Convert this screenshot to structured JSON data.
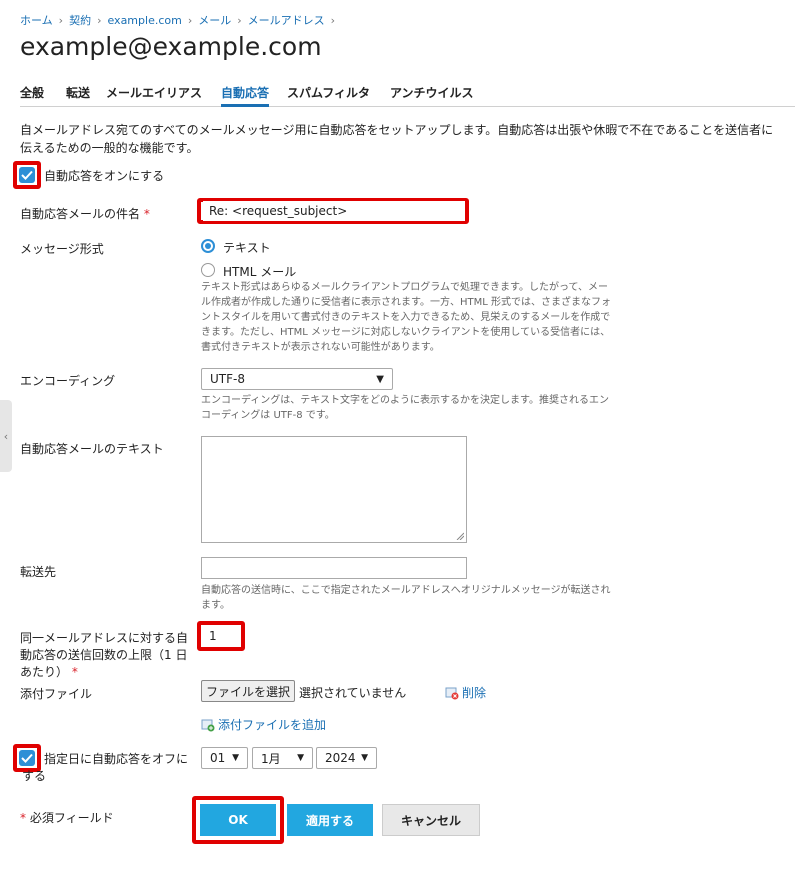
{
  "breadcrumb": [
    "ホーム",
    "契約",
    "example.com",
    "メール",
    "メールアドレス"
  ],
  "page_title": "example@example.com",
  "tabs": [
    {
      "label": "全般",
      "active": false
    },
    {
      "label": "転送",
      "active": false
    },
    {
      "label": "メールエイリアス",
      "active": false
    },
    {
      "label": "自動応答",
      "active": true
    },
    {
      "label": "スパムフィルタ",
      "active": false
    },
    {
      "label": "アンチウイルス",
      "active": false
    }
  ],
  "intro": "自メールアドレス宛てのすべてのメールメッセージ用に自動応答をセットアップします。自動応答は出張や休暇で不在であることを送信者に伝えるための一般的な機能です。",
  "enable_autoresponder": {
    "label": "自動応答をオンにする",
    "checked": true
  },
  "subject": {
    "label": "自動応答メールの件名",
    "required": "*",
    "value": "Re: <request_subject>"
  },
  "format": {
    "label": "メッセージ形式",
    "options": [
      "テキスト",
      "HTML メール"
    ],
    "selected": "テキスト",
    "hint": "テキスト形式はあらゆるメールクライアントプログラムで処理できます。したがって、メール作成者が作成した通りに受信者に表示されます。一方、HTML 形式では、さまざまなフォントスタイルを用いて書式付きのテキストを入力できるため、見栄えのするメールを作成できます。ただし、HTML メッセージに対応しないクライアントを使用している受信者には、書式付きテキストが表示されない可能性があります。"
  },
  "encoding": {
    "label": "エンコーディング",
    "value": "UTF-8",
    "hint": "エンコーディングは、テキスト文字をどのように表示するかを決定します。推奨されるエンコーディングは UTF-8 です。"
  },
  "body_text": {
    "label": "自動応答メールのテキスト",
    "value": ""
  },
  "forward_to": {
    "label": "転送先",
    "value": "",
    "hint": "自動応答の送信時に、ここで指定されたメールアドレスへオリジナルメッセージが転送されます。"
  },
  "limit": {
    "label": "同一メールアドレスに対する自動応答の送信回数の上限（1 日あたり）",
    "required": "*",
    "value": "1"
  },
  "attachment": {
    "label": "添付ファイル",
    "choose_button": "ファイルを選択",
    "no_file": "選択されていません",
    "delete_label": "削除",
    "add_label": "添付ファイルを追加"
  },
  "auto_off": {
    "label": "指定日に自動応答をオフにする",
    "checked": true,
    "day": "01",
    "month": "1月",
    "year": "2024"
  },
  "required_note": {
    "star": "*",
    "label": "必須フィールド"
  },
  "buttons": {
    "ok": "OK",
    "apply": "適用する",
    "cancel": "キャンセル"
  },
  "colors": {
    "accent": "#2d8fd6",
    "primary_button": "#22a7e0",
    "highlight": "#e00000",
    "required": "#d9222a"
  }
}
